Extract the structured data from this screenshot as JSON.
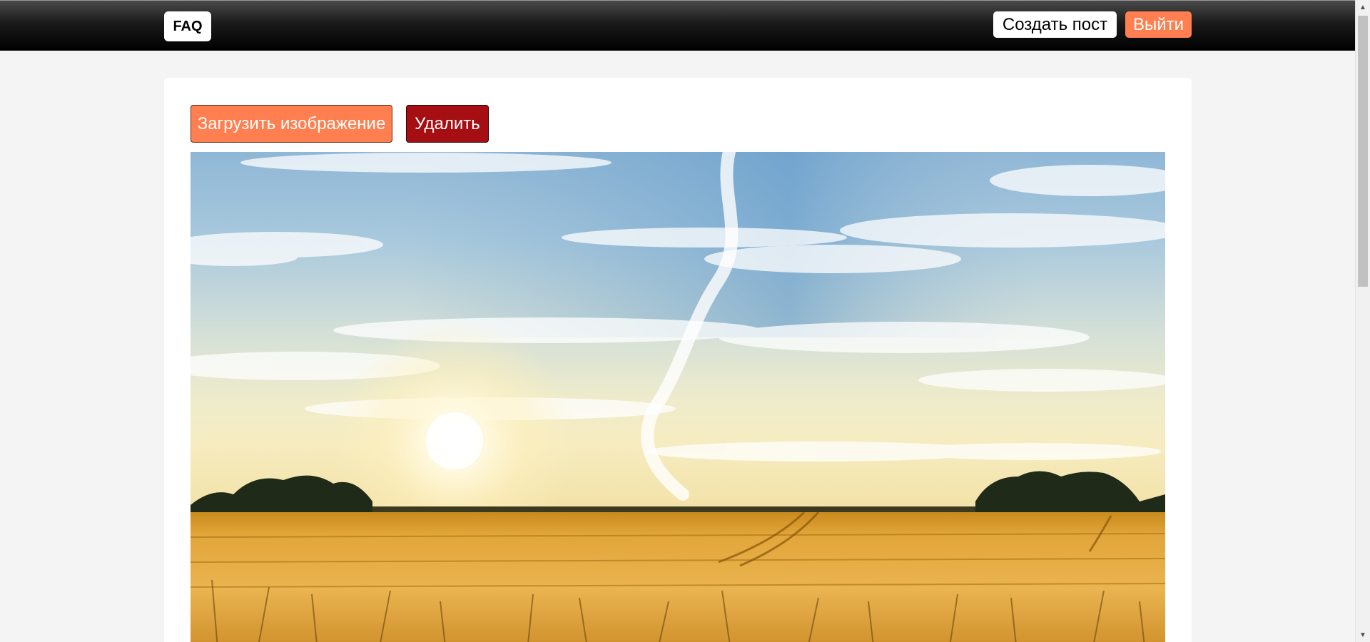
{
  "header": {
    "logo_label": "FAQ",
    "create_post_label": "Создать пост",
    "logout_label": "Выйти"
  },
  "actions": {
    "upload_label": "Загрузить изображение",
    "delete_label": "Удалить"
  },
  "colors": {
    "accent": "#ff7f50",
    "danger": "#a50f14",
    "header": "#000000",
    "page_background": "#f4f4f4"
  },
  "image": {
    "subject": "wheat field at sunset"
  },
  "scrollbar": {
    "up_icon": "arrow-up-icon",
    "down_icon": "arrow-down-icon"
  }
}
